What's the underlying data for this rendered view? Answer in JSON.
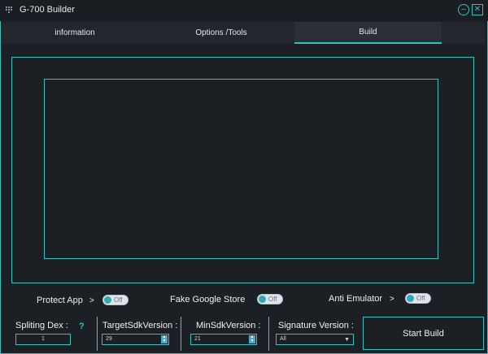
{
  "window": {
    "title": "G-700 Builder",
    "icons": {
      "app": "app-grid-icon",
      "minimize": "minimize-icon",
      "close": "close-icon"
    }
  },
  "tabs": [
    {
      "label": "information",
      "active": false
    },
    {
      "label": "Options /Tools",
      "active": false
    },
    {
      "label": "Build",
      "active": true
    }
  ],
  "options": {
    "arrow": ">",
    "protect_app": {
      "label": "Protect App",
      "state": "Off"
    },
    "fake_google_store": {
      "label": "Fake Google Store",
      "state": "Off"
    },
    "anti_emulator": {
      "label": "Anti Emulator",
      "state": "Off"
    }
  },
  "build": {
    "spliting_dex": {
      "label": "Spliting Dex :",
      "value": "1",
      "help": "?"
    },
    "target_sdk": {
      "label": "TargetSdkVersion :",
      "value": "29"
    },
    "min_sdk": {
      "label": "MinSdkVersion :",
      "value": "21"
    },
    "signature": {
      "label": "Signature Version :",
      "value": "All"
    },
    "start_button": "Start Build"
  },
  "colors": {
    "accent": "#34c0c0",
    "background": "#1c1f24",
    "toggle_knob": "#2fa8b8"
  }
}
